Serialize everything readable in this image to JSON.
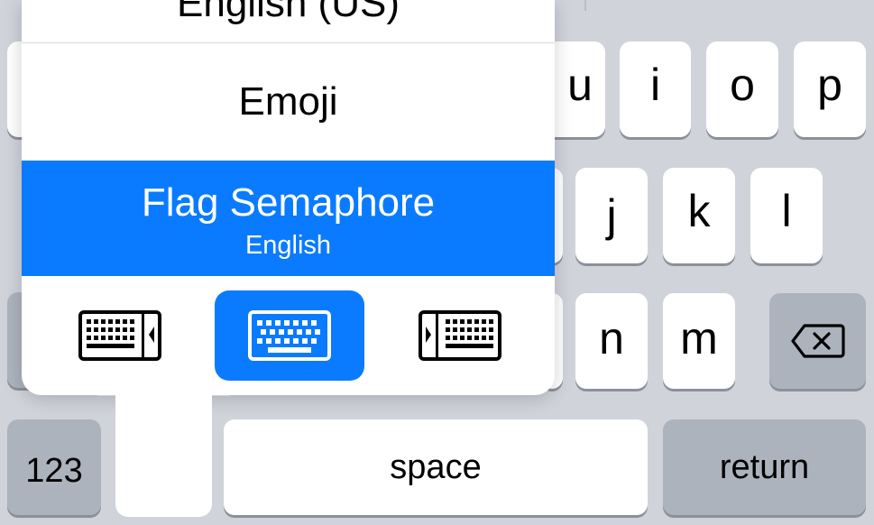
{
  "popup": {
    "previous_item": "English (US)",
    "items": [
      {
        "label": "Emoji"
      },
      {
        "label": "Flag Semaphore",
        "sublabel": "English",
        "selected": true
      }
    ],
    "modes": [
      {
        "icon": "keyboard-left-icon"
      },
      {
        "icon": "keyboard-center-icon",
        "active": true
      },
      {
        "icon": "keyboard-right-icon"
      }
    ]
  },
  "keys": {
    "u": "u",
    "i": "i",
    "o": "o",
    "p": "p",
    "j": "j",
    "k": "k",
    "l": "l",
    "n": "n",
    "m": "m",
    "numbers": "123",
    "space": "space",
    "return": "return",
    "backspace_icon": "backspace-icon"
  },
  "colors": {
    "accent": "#0a7bff",
    "keyboard_bg": "#d0d3da",
    "key": "#ffffff",
    "key_function": "#adb3bd"
  }
}
